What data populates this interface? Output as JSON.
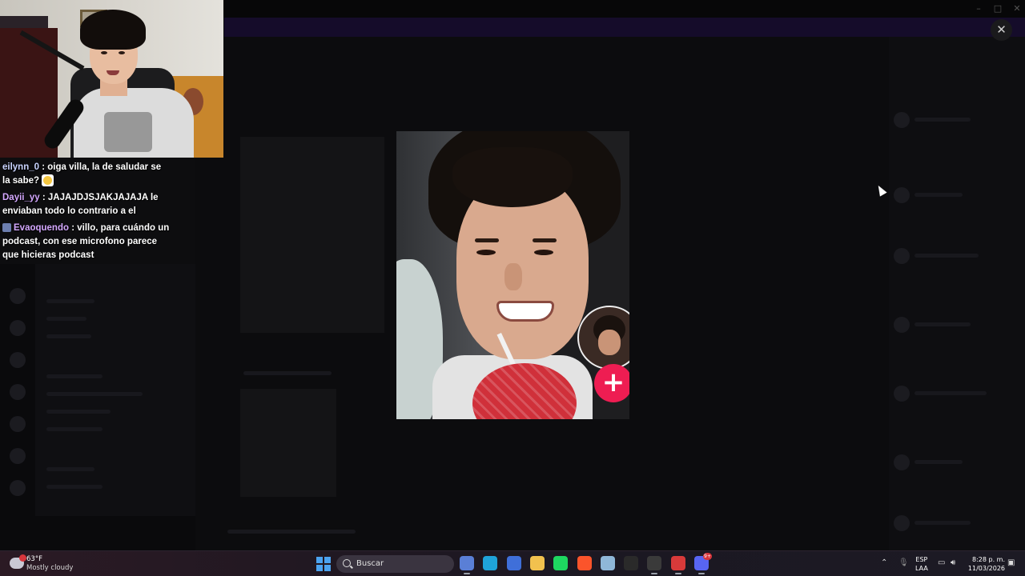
{
  "chat": {
    "messages": [
      {
        "user": "eilynn_0",
        "user_color": "#c9d4ff",
        "text": " : oiga villa, la de saludar se la sabe? ",
        "emoji": "smiling-face-emoji"
      },
      {
        "user": "Dayii_yy",
        "user_color": "#d4a8ff",
        "text": " : JAJAJDJSJAKJAJAJA le enviaban todo lo contrario a el"
      },
      {
        "user": "Evaoquendo",
        "user_color": "#d4a8ff",
        "text": " : villo, para cuándo un podcast, con ese microfono parece que hicieras podcast",
        "badge": "subscriber-badge-icon"
      }
    ]
  },
  "lightbox": {
    "close_glyph": "✕",
    "plus_glyph": "+",
    "image_subject": "tiktok-video-thumbnail"
  },
  "taskbar": {
    "weather": {
      "temp": "63°F",
      "desc": "Mostly cloudy",
      "icon": "cloud-icon"
    },
    "search": {
      "label": "Buscar"
    },
    "apps": [
      {
        "name": "file-explorer-app-icon",
        "color": "#5a7fd6",
        "active": true
      },
      {
        "name": "edge-app-icon",
        "color": "#1fa3d9",
        "active": false
      },
      {
        "name": "microsoft-store-app-icon",
        "color": "#3f6fd9",
        "active": false
      },
      {
        "name": "folder-app-icon",
        "color": "#f2c14e",
        "active": false
      },
      {
        "name": "spotify-app-icon",
        "color": "#1ed760",
        "active": false
      },
      {
        "name": "brave-app-icon",
        "color": "#fb542b",
        "active": false
      },
      {
        "name": "steam-app-icon",
        "color": "#8fb7d8",
        "active": false
      },
      {
        "name": "epic-games-app-icon",
        "color": "#2a2a2a",
        "active": false
      },
      {
        "name": "obs-app-icon",
        "color": "#3a3a3a",
        "active": true
      },
      {
        "name": "game-app-icon",
        "color": "#d83a3a",
        "active": true
      },
      {
        "name": "discord-app-icon",
        "color": "#5865f2",
        "active": true,
        "badge": "9+"
      }
    ],
    "language": {
      "line1": "ESP",
      "line2": "LAA"
    },
    "clock": {
      "time": "8:28 p. m.",
      "date": "11/03/2026"
    }
  },
  "colors": {
    "accent_plus": "#ee1d52",
    "discord_blurple": "#5865f2",
    "windows_blue": "#4ba3f0"
  }
}
